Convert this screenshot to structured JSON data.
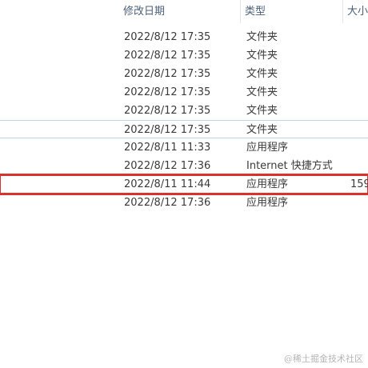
{
  "columns": {
    "modified": "修改日期",
    "type": "类型",
    "size": "大小"
  },
  "rows": [
    {
      "modified": "2022/8/12 17:35",
      "type": "文件夹",
      "size": ""
    },
    {
      "modified": "2022/8/12 17:35",
      "type": "文件夹",
      "size": ""
    },
    {
      "modified": "2022/8/12 17:35",
      "type": "文件夹",
      "size": ""
    },
    {
      "modified": "2022/8/12 17:35",
      "type": "文件夹",
      "size": ""
    },
    {
      "modified": "2022/8/12 17:35",
      "type": "文件夹",
      "size": ""
    },
    {
      "modified": "2022/8/12 17:35",
      "type": "文件夹",
      "size": ""
    },
    {
      "modified": "2022/8/11 11:33",
      "type": "应用程序",
      "size": ""
    },
    {
      "modified": "2022/8/12 17:36",
      "type": "Internet 快捷方式",
      "size": ""
    },
    {
      "modified": "2022/8/11 11:44",
      "type": "应用程序",
      "size": "159"
    },
    {
      "modified": "2022/8/12 17:36",
      "type": "应用程序",
      "size": ""
    }
  ],
  "watermark": "@稀土掘金技术社区",
  "colors": {
    "highlight": "#d9322b",
    "header_text": "#4c607a",
    "selection_border": "#bfd7ea"
  }
}
